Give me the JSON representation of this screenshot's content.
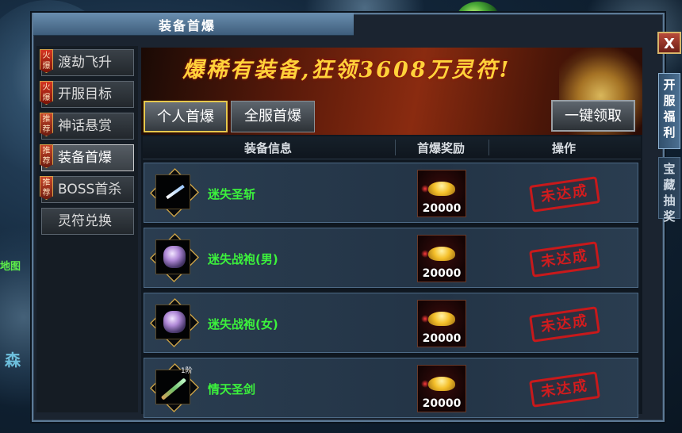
{
  "window": {
    "title": "装备首爆",
    "close_label": "X"
  },
  "side_tabs": [
    {
      "label": "开服福利",
      "active": true
    },
    {
      "label": "宝藏抽奖",
      "active": false
    }
  ],
  "left_hud": {
    "text1": "地图",
    "text2": "森"
  },
  "menu": {
    "items": [
      {
        "label": "渡劫飞升",
        "badge": "火爆",
        "selected": false
      },
      {
        "label": "开服目标",
        "badge": "火爆",
        "selected": false
      },
      {
        "label": "神话悬赏",
        "badge": "推荐",
        "selected": false
      },
      {
        "label": "装备首爆",
        "badge": "推荐",
        "selected": true
      },
      {
        "label": "BOSS首杀",
        "badge": "推荐",
        "selected": false
      },
      {
        "label": "灵符兑换",
        "badge": "",
        "selected": false
      }
    ]
  },
  "banner": {
    "text": "爆稀有装备,狂领3608万灵符!"
  },
  "tabs": {
    "personal": "个人首爆",
    "server": "全服首爆"
  },
  "claim_all_label": "一键领取",
  "table": {
    "headers": {
      "info": "装备信息",
      "reward": "首爆奖励",
      "action": "操作"
    },
    "rows": [
      {
        "name": "迷失圣斩",
        "icon": "dagger-icon",
        "reward": "20000",
        "status": "未达成"
      },
      {
        "name": "迷失战袍(男)",
        "icon": "armor-icon",
        "reward": "20000",
        "status": "未达成"
      },
      {
        "name": "迷失战袍(女)",
        "icon": "armor-icon",
        "reward": "20000",
        "status": "未达成"
      },
      {
        "name": "情天圣剑",
        "icon": "sword-icon",
        "tier": "1阶",
        "reward": "20000",
        "status": "未达成"
      }
    ]
  },
  "colors": {
    "item_name": "#3cf23c",
    "banner_text": "#ffd23a",
    "stamp": "#c8191b"
  }
}
